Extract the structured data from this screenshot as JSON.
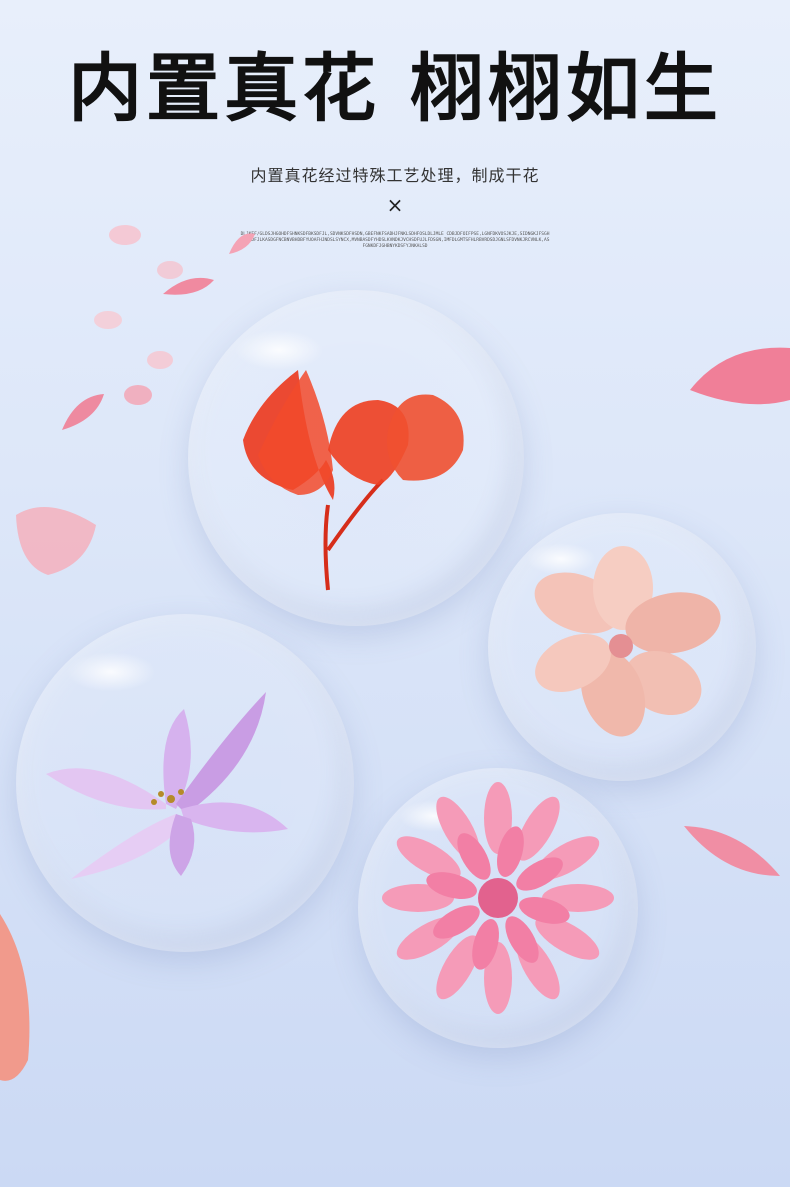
{
  "headline": "内置真花 栩栩如生",
  "subline": "内置真花经过特殊工艺处理，制成干花",
  "times_symbol": "×",
  "fine_print": "DLJKEF/GLDSJHGOHDFSHNKSDFBKSDFJL,SDVNKSDFHSDN,GBEFNKFSADHJFNKLSDHFOSLDLJMLE CDBJDFOIFPSE,LGNFDKVOSJKJE,SIDNGKJFSGHBVKSDFJLKASDGFNCBNVBHDBFYUOAFHJNDSLSYNCX,MVNBASDFYHDSLKVNDKJVCHSDFUJLFDSGN,IMFDLGMTSFHLRBVRDSDJGNLSFDVNKJRCVNLK,ASFGNKDFJGHBNYKDSFYJNKALSD",
  "colors": {
    "background_top": "#e8effb",
    "background_bottom": "#cbd9f4",
    "headline": "#111111",
    "flower_red": "#e8391f",
    "flower_peach": "#f2b9ae",
    "flower_lilac": "#c89be6",
    "flower_pink": "#f28cad",
    "petal_pink": "#f28ca6"
  },
  "decor": {
    "bubble_icons": [
      "red-hydrangea-icon",
      "peach-magnolia-icon",
      "lilac-lily-icon",
      "pink-dahlia-icon"
    ]
  }
}
